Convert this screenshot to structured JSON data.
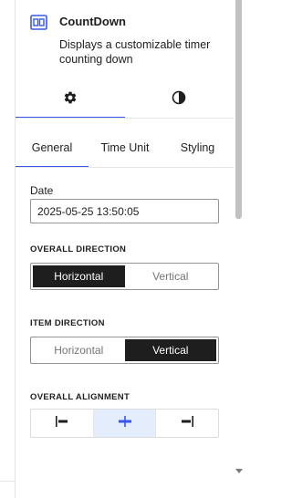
{
  "block": {
    "title": "CountDown",
    "description": "Displays a customizable timer counting down",
    "icon": "countdown-block-icon"
  },
  "panel_tabs": [
    {
      "icon": "gear-icon",
      "active": true
    },
    {
      "icon": "contrast-half-circle-icon",
      "active": false
    }
  ],
  "inner_tabs": [
    {
      "label": "General",
      "active": true
    },
    {
      "label": "Time Unit",
      "active": false
    },
    {
      "label": "Styling",
      "active": false
    }
  ],
  "date": {
    "label": "Date",
    "value": "2025-05-25 13:50:05"
  },
  "overall_direction": {
    "label": "Overall Direction",
    "options": [
      "Horizontal",
      "Vertical"
    ],
    "selected": "Horizontal"
  },
  "item_direction": {
    "label": "Item Direction",
    "options": [
      "Horizontal",
      "Vertical"
    ],
    "selected": "Vertical"
  },
  "overall_alignment": {
    "label": "Overall Alignment",
    "options": [
      "justify-left-icon",
      "justify-center-icon",
      "justify-right-icon"
    ],
    "selected": "justify-center-icon"
  },
  "colors": {
    "accent": "#3858e9",
    "selected_toggle": "#1e1e1e",
    "selected_alignment_bg": "#e3edfc"
  }
}
